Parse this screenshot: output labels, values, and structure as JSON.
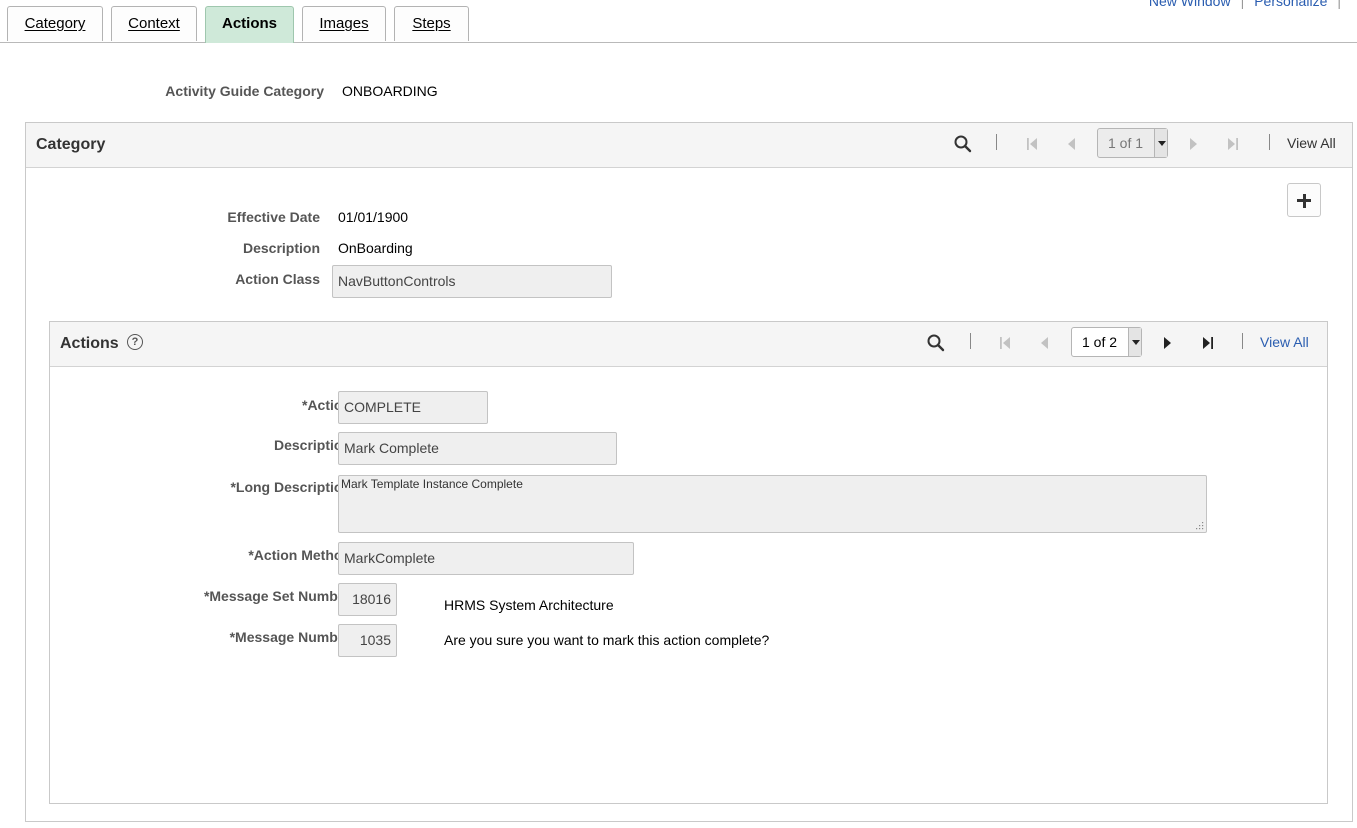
{
  "header": {
    "links": [
      "New Window",
      "Personalize"
    ]
  },
  "tabs": [
    {
      "label": "Category"
    },
    {
      "label": "Context"
    },
    {
      "label": "Actions"
    },
    {
      "label": "Images"
    },
    {
      "label": "Steps"
    }
  ],
  "activity_guide": {
    "label": "Activity Guide Category",
    "value": "ONBOARDING"
  },
  "category": {
    "title": "Category",
    "pager": "1 of 1",
    "view_all": "View All",
    "effective_date_label": "Effective Date",
    "effective_date": "01/01/1900",
    "description_label": "Description",
    "description": "OnBoarding",
    "action_class_label": "Action Class",
    "action_class": "NavButtonControls"
  },
  "actions": {
    "title": "Actions",
    "pager": "1 of 2",
    "view_all": "View All",
    "action_label": "*Action",
    "action": "COMPLETE",
    "description_label": "Description",
    "description": "Mark Complete",
    "long_description_label": "*Long Description",
    "long_description": "Mark Template Instance Complete",
    "action_method_label": "*Action Method",
    "action_method": "MarkComplete",
    "message_set_label": "*Message Set Number",
    "message_set": "18016",
    "message_set_desc": "HRMS System Architecture",
    "message_number_label": "*Message Number",
    "message_number": "1035",
    "message_text": "Are you sure you want to mark this action complete?"
  },
  "colors": {
    "active_tab": "#cfe9d9",
    "link": "#2a5db0",
    "label": "#555555"
  }
}
